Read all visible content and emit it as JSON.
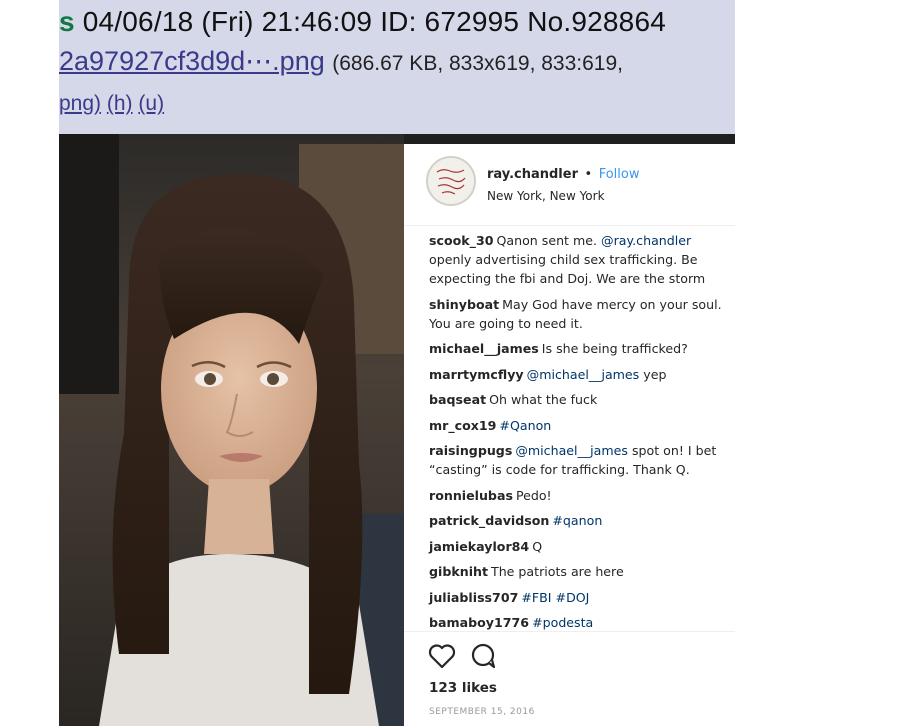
{
  "post_header": {
    "name_fragment": "s",
    "datetime": "04/06/18 (Fri) 21:46:09",
    "id_label": "ID: 672995",
    "post_no": "No.928864",
    "file_name": "2a97927cf3d9d⋯.png",
    "file_meta": "(686.67 KB, 833x619, 833:619,",
    "file_ext": "png)",
    "link_h": "(h)",
    "link_u": "(u)"
  },
  "instagram": {
    "username": "ray.chandler",
    "separator": "•",
    "follow_label": "Follow",
    "location": "New York, New York",
    "comments": [
      {
        "user": "scook_30",
        "parts": [
          {
            "t": "Qanon sent me. "
          },
          {
            "t": "@ray.chandler",
            "k": "mention"
          },
          {
            "t": " openly advertising child sex trafficking. Be expecting the fbi and Doj. We are the storm"
          }
        ]
      },
      {
        "user": "shinyboat",
        "parts": [
          {
            "t": "May God have mercy on your soul. You are going to need it."
          }
        ]
      },
      {
        "user": "michael__james",
        "parts": [
          {
            "t": "Is she being trafficked?"
          }
        ]
      },
      {
        "user": "marrtymcflyy",
        "parts": [
          {
            "t": "@michael__james",
            "k": "mention"
          },
          {
            "t": " yep"
          }
        ]
      },
      {
        "user": "baqseat",
        "parts": [
          {
            "t": "Oh what the fuck"
          }
        ]
      },
      {
        "user": "mr_cox19",
        "parts": [
          {
            "t": "#Qanon",
            "k": "tag"
          }
        ]
      },
      {
        "user": "raisingpugs",
        "parts": [
          {
            "t": "@michael__james",
            "k": "mention"
          },
          {
            "t": " spot on! I bet “casting” is code for trafficking. Thank Q."
          }
        ]
      },
      {
        "user": "ronnielubas",
        "parts": [
          {
            "t": "Pedo!"
          }
        ]
      },
      {
        "user": "patrick_davidson",
        "parts": [
          {
            "t": "#qanon",
            "k": "tag"
          }
        ]
      },
      {
        "user": "jamiekaylor84",
        "parts": [
          {
            "t": "Q"
          }
        ]
      },
      {
        "user": "gibkniht",
        "parts": [
          {
            "t": "The patriots are here"
          }
        ]
      },
      {
        "user": "juliabliss707",
        "parts": [
          {
            "t": "#FBI",
            "k": "tag"
          },
          {
            "t": " "
          },
          {
            "t": "#DOJ",
            "k": "tag"
          }
        ]
      },
      {
        "user": "bamaboy1776",
        "parts": [
          {
            "t": "#podesta",
            "k": "tag"
          }
        ]
      }
    ],
    "likes": "123 likes",
    "date": "SEPTEMBER 15, 2016",
    "icons": {
      "like": "heart-icon",
      "comment": "comment-icon"
    }
  },
  "colors": {
    "header_bg": "#d5d8e9",
    "name_green": "#117743",
    "follow_blue": "#3897f0",
    "link_navy": "#003569"
  }
}
